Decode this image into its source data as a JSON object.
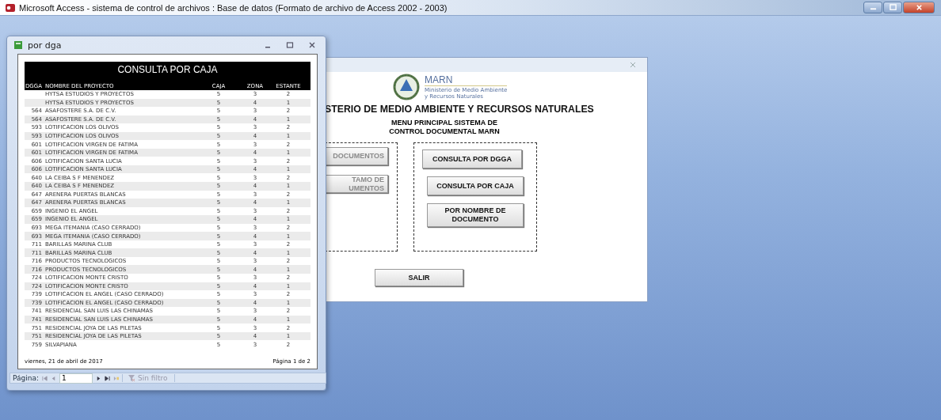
{
  "app_window": {
    "title": "Microsoft Access - sistema de control de archivos : Base de datos (Formato de archivo de Access 2002 - 2003)"
  },
  "report_window": {
    "title": "por dga",
    "report": {
      "title": "CONSULTA POR CAJA",
      "columns": [
        "DGGA",
        "NOMBRE DEL PROYECTO",
        "CAJA",
        "ZONA",
        "ESTANTE"
      ],
      "rows": [
        [
          "",
          "HYTSA ESTUDIOS Y PROYECTOS",
          "5",
          "3",
          "2"
        ],
        [
          "",
          "HYTSA ESTUDIOS Y PROYECTOS",
          "5",
          "4",
          "1"
        ],
        [
          "564",
          "ASAFOSTERE S.A. DE C.V.",
          "5",
          "3",
          "2"
        ],
        [
          "564",
          "ASAFOSTERE S.A. DE C.V.",
          "5",
          "4",
          "1"
        ],
        [
          "593",
          "LOTIFICACION LOS OLIVOS",
          "5",
          "3",
          "2"
        ],
        [
          "593",
          "LOTIFICACION LOS OLIVOS",
          "5",
          "4",
          "1"
        ],
        [
          "601",
          "LOTIFICACION VIRGEN DE FATIMA",
          "5",
          "3",
          "2"
        ],
        [
          "601",
          "LOTIFICACION VIRGEN DE FATIMA",
          "5",
          "4",
          "1"
        ],
        [
          "606",
          "LOTIFICACION SANTA LUCIA",
          "5",
          "3",
          "2"
        ],
        [
          "606",
          "LOTIFICACION SANTA LUCIA",
          "5",
          "4",
          "1"
        ],
        [
          "640",
          "LA CEIBA S F MENENDEZ",
          "5",
          "3",
          "2"
        ],
        [
          "640",
          "LA CEIBA S F MENENDEZ",
          "5",
          "4",
          "1"
        ],
        [
          "647",
          "ARENERA PUERTAS BLANCAS",
          "5",
          "3",
          "2"
        ],
        [
          "647",
          "ARENERA PUERTAS BLANCAS",
          "5",
          "4",
          "1"
        ],
        [
          "659",
          "INGENIO EL ANGEL",
          "5",
          "3",
          "2"
        ],
        [
          "659",
          "INGENIO EL ANGEL",
          "5",
          "4",
          "1"
        ],
        [
          "693",
          "MEGA ITEMANIA (CASO CERRADO)",
          "5",
          "3",
          "2"
        ],
        [
          "693",
          "MEGA ITEMANIA (CASO CERRADO)",
          "5",
          "4",
          "1"
        ],
        [
          "711",
          "BARILLAS MARINA CLUB",
          "5",
          "3",
          "2"
        ],
        [
          "711",
          "BARILLAS MARINA CLUB",
          "5",
          "4",
          "1"
        ],
        [
          "716",
          "PRODUCTOS TECNOLOGICOS",
          "5",
          "3",
          "2"
        ],
        [
          "716",
          "PRODUCTOS TECNOLOGICOS",
          "5",
          "4",
          "1"
        ],
        [
          "724",
          "LOTIFICACION MONTE CRISTO",
          "5",
          "3",
          "2"
        ],
        [
          "724",
          "LOTIFICACION MONTE CRISTO",
          "5",
          "4",
          "1"
        ],
        [
          "739",
          "LOTIFICACION EL ANGEL (CASO CERRADO)",
          "5",
          "3",
          "2"
        ],
        [
          "739",
          "LOTIFICACION EL ANGEL (CASO CERRADO)",
          "5",
          "4",
          "1"
        ],
        [
          "741",
          "RESIDENCIAL SAN LUIS LAS CHINAMAS",
          "5",
          "3",
          "2"
        ],
        [
          "741",
          "RESIDENCIAL SAN LUIS LAS CHINAMAS",
          "5",
          "4",
          "1"
        ],
        [
          "751",
          "RESIDENCIAL JOYA DE LAS PILETAS",
          "5",
          "3",
          "2"
        ],
        [
          "751",
          "RESIDENCIAL JOYA DE LAS PILETAS",
          "5",
          "4",
          "1"
        ],
        [
          "759",
          "SILVAPIANA",
          "5",
          "3",
          "2"
        ]
      ],
      "footer_date": "viernes, 21 de abril de 2017",
      "footer_page": "Página 1 de 2"
    },
    "navigation": {
      "label": "Página:",
      "page": "1",
      "filter": "Sin filtro"
    }
  },
  "menu_window": {
    "logo_name": "MARN",
    "logo_subtitle": [
      "Ministerio de Medio Ambiente",
      "y Recursos Naturales"
    ],
    "heading": "STERIO DE MEDIO AMBIENTE Y RECURSOS NATURALES",
    "subtitle": [
      "MENU PRINCIPAL SISTEMA DE",
      "CONTROL DOCUMENTAL MARN"
    ],
    "left_buttons": [
      {
        "label": [
          "DOCUMENTOS"
        ],
        "disabled": true
      },
      {
        "label": [
          "TAMO DE",
          "UMENTOS"
        ],
        "disabled": true
      }
    ],
    "right_buttons": [
      {
        "label": [
          "CONSULTA POR DGGA"
        ],
        "disabled": false
      },
      {
        "label": [
          "CONSULTA POR CAJA"
        ],
        "disabled": false
      },
      {
        "label": [
          "POR NOMBRE DE",
          "DOCUMENTO"
        ],
        "disabled": false
      }
    ],
    "exit_button": "SALIR"
  }
}
